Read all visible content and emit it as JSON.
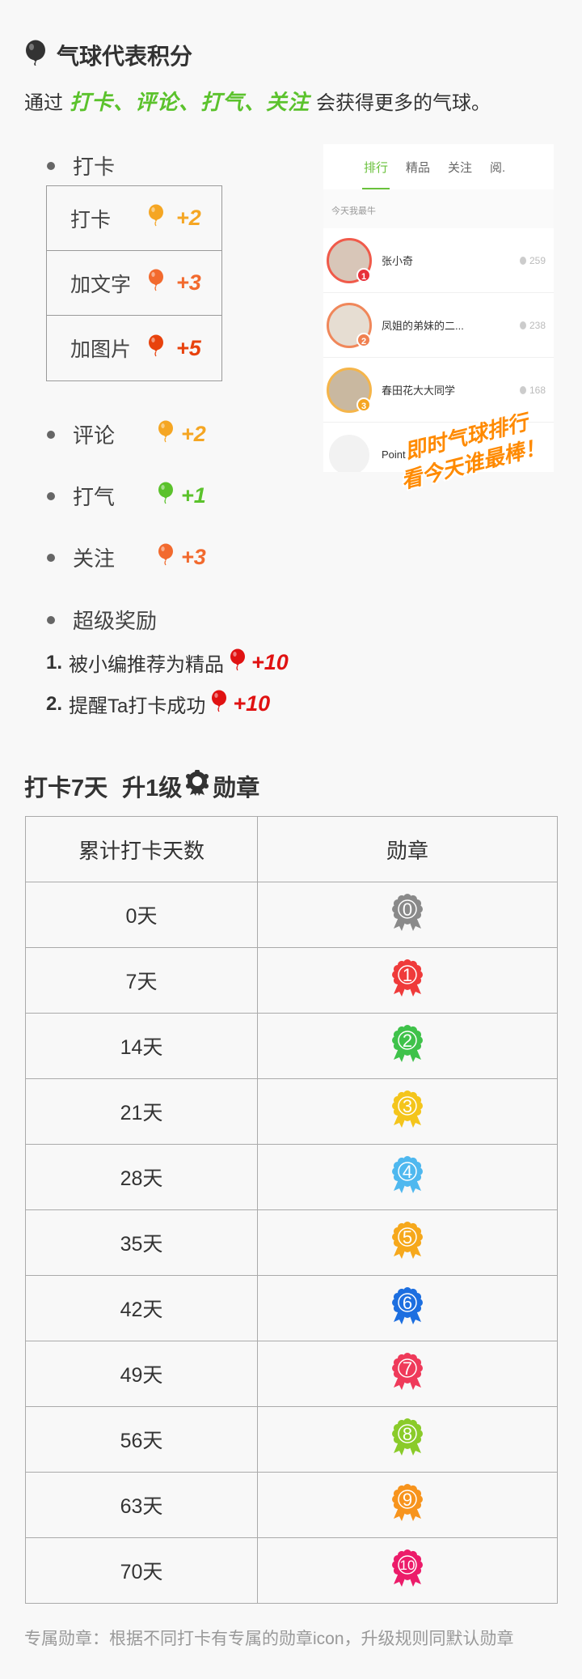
{
  "header": {
    "title": "气球代表积分"
  },
  "intro": {
    "before": "通过",
    "highlight": "打卡、评论、打气、关注",
    "after": "会获得更多的气球。"
  },
  "checkin": {
    "label": "打卡",
    "rows": [
      {
        "label": "打卡",
        "points": "+2",
        "color": "#f5a623"
      },
      {
        "label": "加文字",
        "points": "+3",
        "color": "#f26a2e"
      },
      {
        "label": "加图片",
        "points": "+5",
        "color": "#e8420d"
      }
    ]
  },
  "actions": [
    {
      "label": "评论",
      "points": "+2",
      "color": "#f5a623"
    },
    {
      "label": "打气",
      "points": "+1",
      "color": "#5bc22c"
    },
    {
      "label": "关注",
      "points": "+3",
      "color": "#f26a2e"
    }
  ],
  "super": {
    "label": "超级奖励",
    "items": [
      {
        "num": "1.",
        "text": "被小编推荐为精品",
        "points": "+10",
        "color": "#e01212"
      },
      {
        "num": "2.",
        "text": "提醒Ta打卡成功",
        "points": "+10",
        "color": "#e01212"
      }
    ]
  },
  "phone": {
    "tabs": [
      "排行",
      "精品",
      "关注",
      "阅."
    ],
    "subtitle": "今天我最牛",
    "rows": [
      {
        "name": "张小奇",
        "count": "259",
        "rank": "1",
        "ring": "#f05a4a",
        "badge": "#e8303a"
      },
      {
        "name": "凤姐的弟妹的二...",
        "count": "238",
        "rank": "2",
        "ring": "#f0875a",
        "badge": "#f08050"
      },
      {
        "name": "春田花大大同学",
        "count": "168",
        "rank": "3",
        "ring": "#f5b54a",
        "badge": "#f5a623"
      },
      {
        "name": "Point",
        "count": "",
        "rank": "",
        "ring": "#ffffff",
        "badge": ""
      }
    ],
    "promo_line1": "即时气球排行",
    "promo_line2": "看今天谁最棒！"
  },
  "medals": {
    "title_part1": "打卡7天",
    "title_part2": "升1级",
    "title_part3": "勋章",
    "header_days": "累计打卡天数",
    "header_medal": "勋章",
    "rows": [
      {
        "days": "0天",
        "level": "0",
        "color": "#8a8a8a"
      },
      {
        "days": "7天",
        "level": "1",
        "color": "#ef3b3b"
      },
      {
        "days": "14天",
        "level": "2",
        "color": "#3fc24a"
      },
      {
        "days": "21天",
        "level": "3",
        "color": "#f4c51c"
      },
      {
        "days": "28天",
        "level": "4",
        "color": "#4fb8ef"
      },
      {
        "days": "35天",
        "level": "5",
        "color": "#f6a81c"
      },
      {
        "days": "42天",
        "level": "6",
        "color": "#1d6fe0"
      },
      {
        "days": "49天",
        "level": "7",
        "color": "#ef3a5a"
      },
      {
        "days": "56天",
        "level": "8",
        "color": "#8acb2a"
      },
      {
        "days": "63天",
        "level": "9",
        "color": "#f7941d"
      },
      {
        "days": "70天",
        "level": "10",
        "color": "#ec1c6a"
      }
    ]
  },
  "footer": "专属勋章：根据不同打卡有专属的勋章icon，升级规则同默认勋章"
}
